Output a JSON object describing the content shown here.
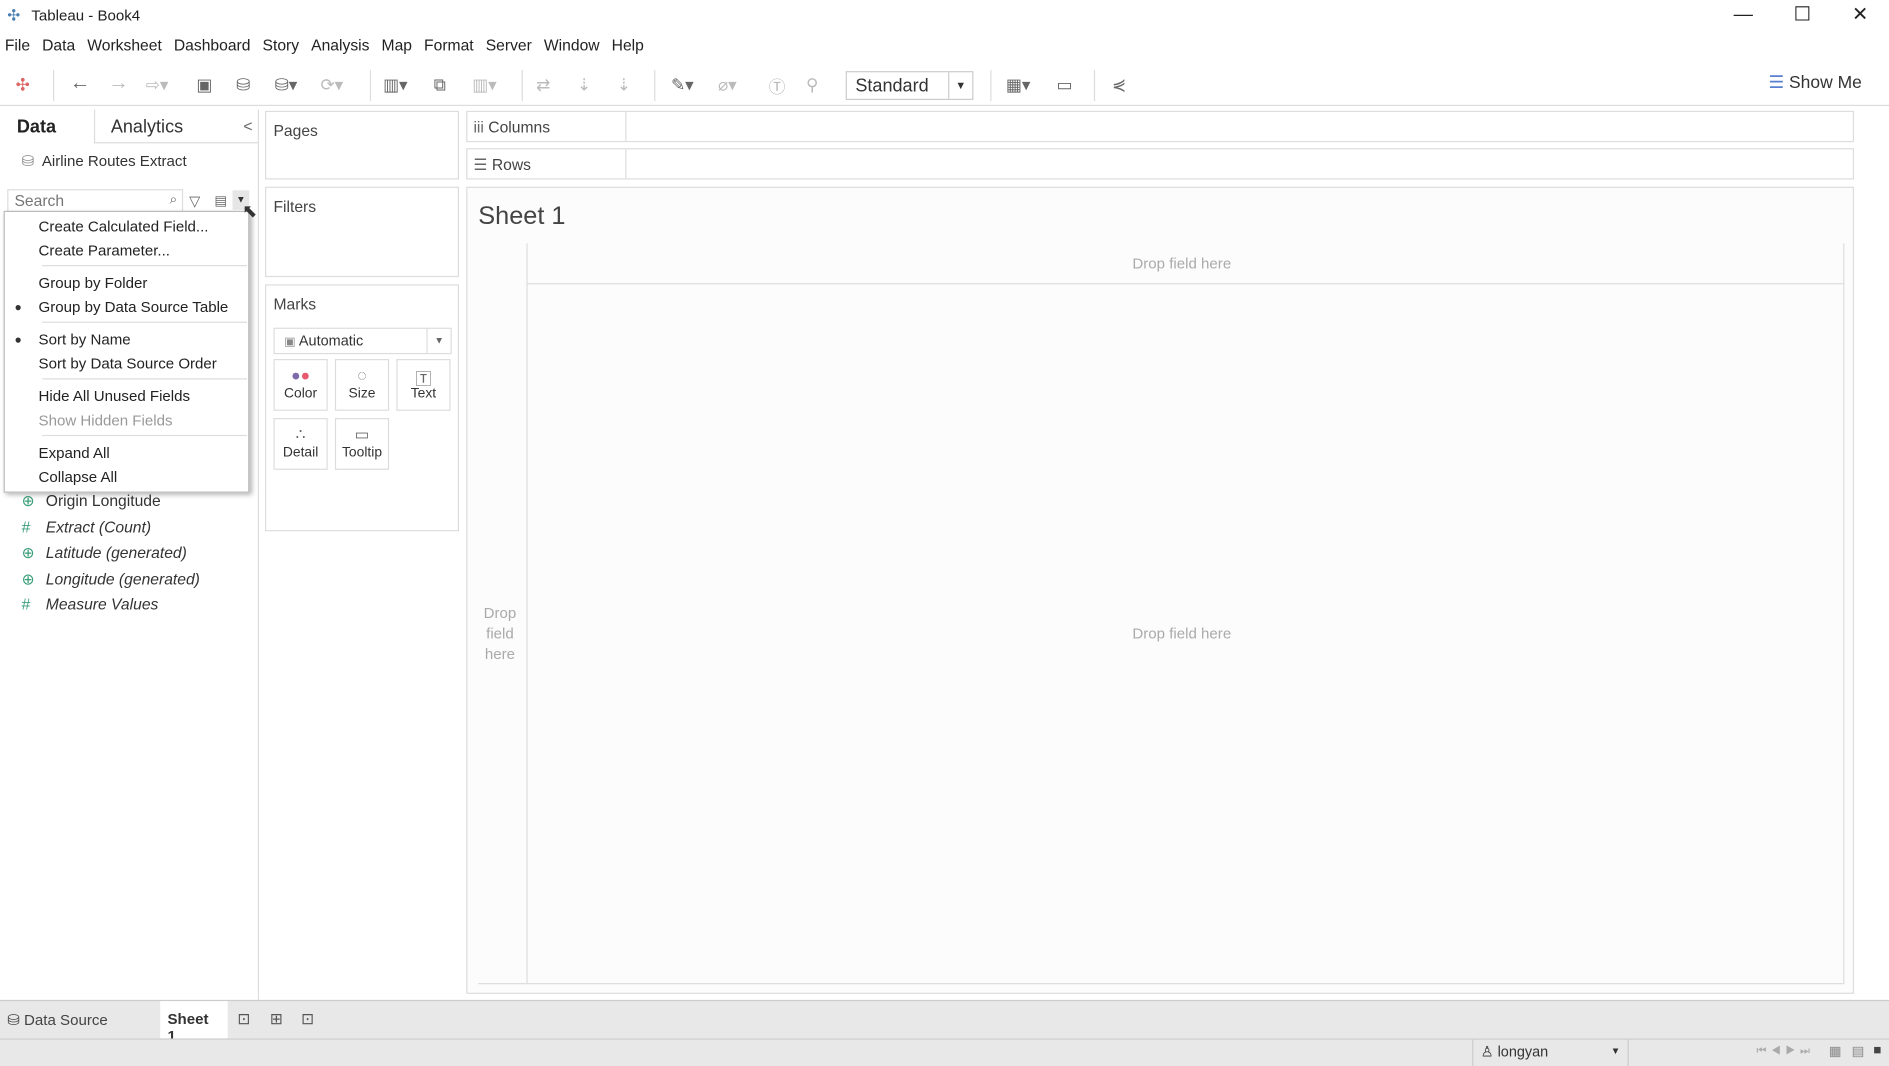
{
  "window": {
    "title": "Tableau - Book4",
    "minimize": "—",
    "maximize": "☐",
    "close": "✕"
  },
  "menubar": [
    "File",
    "Data",
    "Worksheet",
    "Dashboard",
    "Story",
    "Analysis",
    "Map",
    "Format",
    "Server",
    "Window",
    "Help"
  ],
  "toolbar": {
    "fit": "Standard",
    "show_me": "Show Me"
  },
  "data_pane": {
    "tab_data": "Data",
    "tab_analytics": "Analytics",
    "collapse": "<",
    "datasource": "Airline Routes Extract",
    "search_placeholder": "Search",
    "fields": [
      {
        "name": "Origin Longitude",
        "icon": "globe",
        "italic": false
      },
      {
        "name": "Extract (Count)",
        "icon": "hash",
        "italic": true
      },
      {
        "name": "Latitude (generated)",
        "icon": "globe",
        "italic": true
      },
      {
        "name": "Longitude (generated)",
        "icon": "globe",
        "italic": true
      },
      {
        "name": "Measure Values",
        "icon": "hash",
        "italic": true
      }
    ]
  },
  "context_menu": {
    "items": [
      {
        "label": "Create Calculated Field...",
        "checked": false,
        "disabled": false
      },
      {
        "label": "Create Parameter...",
        "checked": false,
        "disabled": false
      },
      {
        "label": "Group by Folder",
        "checked": false,
        "disabled": false
      },
      {
        "label": "Group by Data Source Table",
        "checked": true,
        "disabled": false
      },
      {
        "label": "Sort by Name",
        "checked": true,
        "disabled": false
      },
      {
        "label": "Sort by Data Source Order",
        "checked": false,
        "disabled": false
      },
      {
        "label": "Hide All Unused Fields",
        "checked": false,
        "disabled": false
      },
      {
        "label": "Show Hidden Fields",
        "checked": false,
        "disabled": true
      },
      {
        "label": "Expand All",
        "checked": false,
        "disabled": false
      },
      {
        "label": "Collapse All",
        "checked": false,
        "disabled": false
      }
    ],
    "bullet": "●"
  },
  "cards": {
    "pages": "Pages",
    "filters": "Filters",
    "marks": "Marks",
    "mark_type": "Automatic",
    "mark_buttons": [
      "Color",
      "Size",
      "Text",
      "Detail",
      "Tooltip"
    ]
  },
  "shelves": {
    "columns": "Columns",
    "rows": "Rows"
  },
  "view": {
    "sheet_title": "Sheet 1",
    "drop_top": "Drop field here",
    "drop_left": "Drop field here",
    "drop_center": "Drop field here"
  },
  "tabs": {
    "data_source": "Data Source",
    "sheet": "Sheet 1"
  },
  "status": {
    "user": "longyan"
  }
}
